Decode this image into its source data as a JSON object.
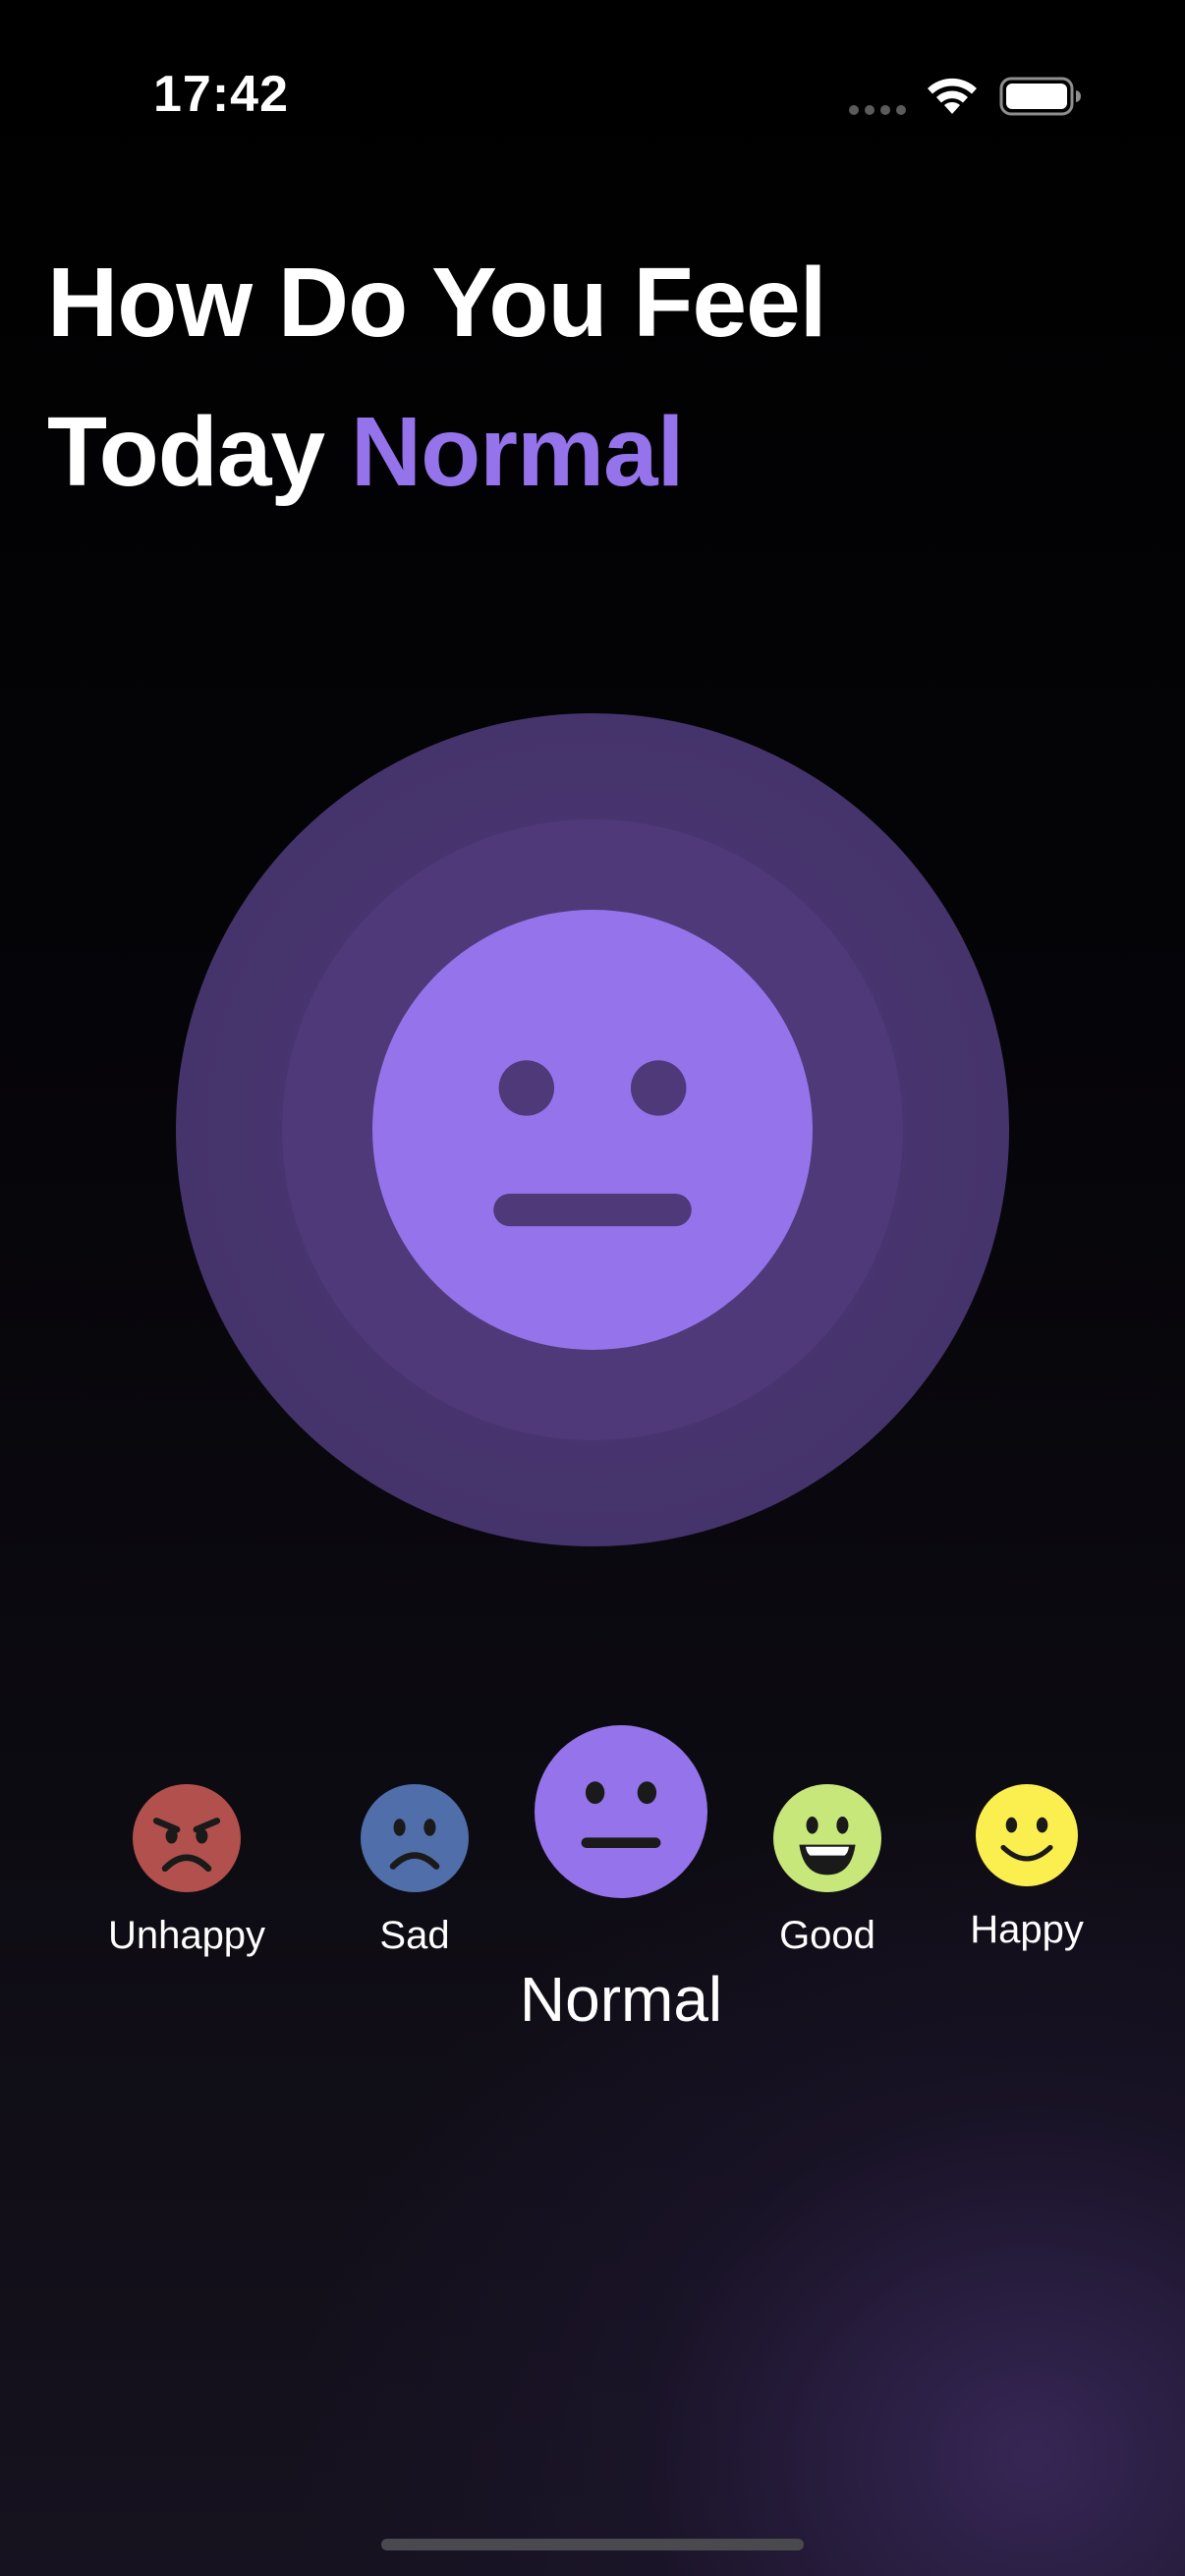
{
  "status_bar": {
    "time": "17:42",
    "icons": [
      "cellular-dots-icon",
      "wifi-icon",
      "battery-icon"
    ]
  },
  "header": {
    "title_line1": "How Do You Feel",
    "title_line2_prefix": "Today",
    "title_selected_mood": "Normal"
  },
  "selected_mood": {
    "name": "Normal",
    "icon": "neutral-face-icon"
  },
  "moods": [
    {
      "label": "Unhappy",
      "icon": "angry-face-icon",
      "color": "#b1504c"
    },
    {
      "label": "Sad",
      "icon": "sad-face-icon",
      "color": "#4f6eaa"
    },
    {
      "label": "Normal",
      "icon": "neutral-face-icon",
      "color": "#9573ea",
      "selected": true
    },
    {
      "label": "Good",
      "icon": "grin-face-icon",
      "color": "#c8e77b"
    },
    {
      "label": "Happy",
      "icon": "smile-face-icon",
      "color": "#fbee4f"
    }
  ],
  "colors": {
    "accent": "#9573ea",
    "background": "#000000"
  }
}
